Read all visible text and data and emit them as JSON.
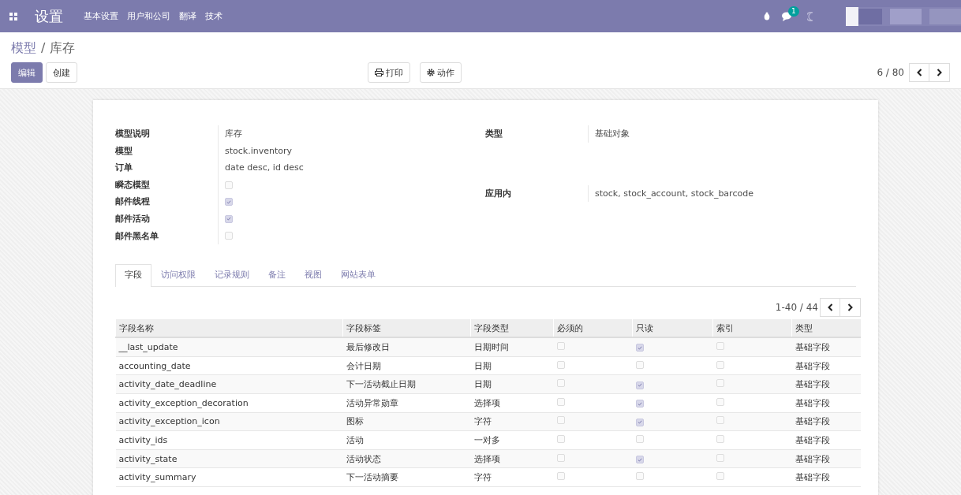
{
  "navbar": {
    "app_title": "设置",
    "menu": [
      "基本设置",
      "用户和公司",
      "翻译",
      "技术"
    ],
    "message_count": "1"
  },
  "breadcrumb": {
    "parent": "模型",
    "separator": "/",
    "current": "库存"
  },
  "buttons": [
    {
      "label": "编辑",
      "kind": "primary"
    },
    {
      "label": "创建",
      "kind": "secondary"
    }
  ],
  "center_buttons": [
    {
      "label": "打印",
      "kind": "print"
    },
    {
      "label": "动作",
      "kind": "gear"
    }
  ],
  "pager": {
    "text": "6 / 80"
  },
  "fields_left": [
    {
      "label": "模型说明",
      "kind": "text",
      "value": "库存"
    },
    {
      "label": "模型",
      "kind": "text",
      "value": "stock.inventory"
    },
    {
      "label": "订单",
      "kind": "text",
      "value": "date desc, id desc"
    },
    {
      "label": "瞬态模型",
      "kind": "checkbox",
      "checked": false
    },
    {
      "label": "邮件线程",
      "kind": "checkbox",
      "checked": true
    },
    {
      "label": "邮件活动",
      "kind": "checkbox",
      "checked": true
    },
    {
      "label": "邮件黑名单",
      "kind": "checkbox",
      "checked": false
    }
  ],
  "fields_right": [
    {
      "label": "类型",
      "kind": "text",
      "value": "基础对象"
    },
    {
      "label": "应用内",
      "kind": "text",
      "value": "stock, stock_account, stock_barcode"
    }
  ],
  "tabs": [
    {
      "label": "字段",
      "selected": true
    },
    {
      "label": "访问权限",
      "selected": false
    },
    {
      "label": "记录规则",
      "selected": false
    },
    {
      "label": "备注",
      "selected": false
    },
    {
      "label": "视图",
      "selected": false
    },
    {
      "label": "网站表单",
      "selected": false
    }
  ],
  "table_pager": {
    "text": "1-40 / 44"
  },
  "table": {
    "columns": [
      "字段名称",
      "字段标签",
      "字段类型",
      "必须的",
      "只读",
      "索引",
      "类型"
    ],
    "rows": [
      {
        "name": "__last_update",
        "label": "最后修改日",
        "type": "日期时间",
        "required": false,
        "readonly": true,
        "indexed": false,
        "kind": "基础字段"
      },
      {
        "name": "accounting_date",
        "label": "会计日期",
        "type": "日期",
        "required": false,
        "readonly": false,
        "indexed": false,
        "kind": "基础字段"
      },
      {
        "name": "activity_date_deadline",
        "label": "下一活动截止日期",
        "type": "日期",
        "required": false,
        "readonly": true,
        "indexed": false,
        "kind": "基础字段"
      },
      {
        "name": "activity_exception_decoration",
        "label": "活动异常勋章",
        "type": "选择项",
        "required": false,
        "readonly": true,
        "indexed": false,
        "kind": "基础字段"
      },
      {
        "name": "activity_exception_icon",
        "label": "图标",
        "type": "字符",
        "required": false,
        "readonly": true,
        "indexed": false,
        "kind": "基础字段"
      },
      {
        "name": "activity_ids",
        "label": "活动",
        "type": "一对多",
        "required": false,
        "readonly": false,
        "indexed": false,
        "kind": "基础字段"
      },
      {
        "name": "activity_state",
        "label": "活动状态",
        "type": "选择项",
        "required": false,
        "readonly": true,
        "indexed": false,
        "kind": "基础字段"
      },
      {
        "name": "activity_summary",
        "label": "下一活动摘要",
        "type": "字符",
        "required": false,
        "readonly": false,
        "indexed": false,
        "kind": "基础字段"
      }
    ]
  }
}
